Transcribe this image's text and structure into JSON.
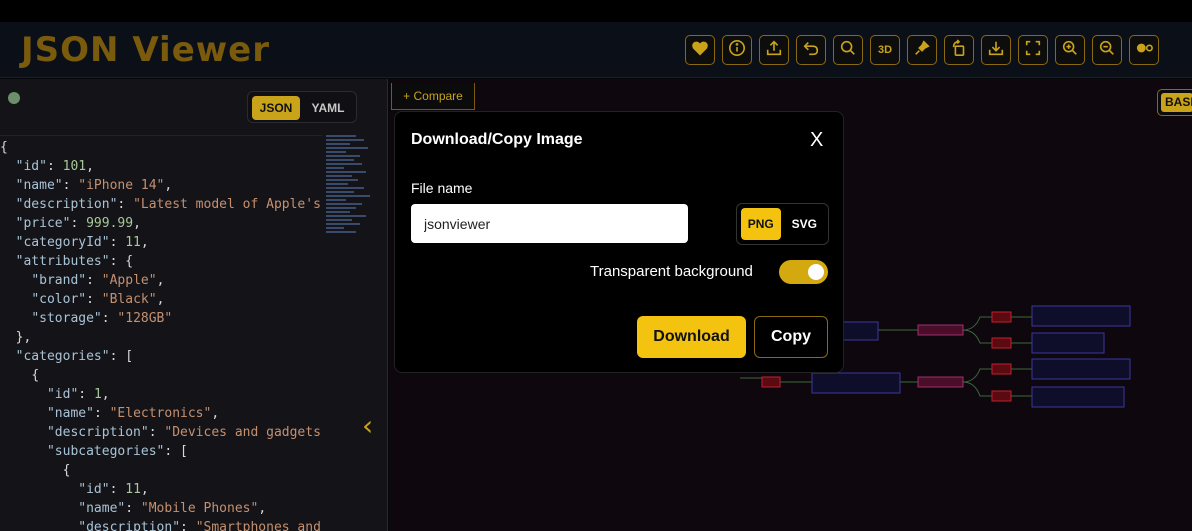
{
  "app": {
    "title": "JSON Viewer"
  },
  "toolbar": {
    "items": [
      {
        "icon": "heart-icon"
      },
      {
        "icon": "info-icon"
      },
      {
        "icon": "upload-icon"
      },
      {
        "icon": "undo-icon"
      },
      {
        "icon": "search-icon"
      },
      {
        "icon": "3d-icon",
        "label": "3D"
      },
      {
        "icon": "pin-icon"
      },
      {
        "icon": "rotate-icon"
      },
      {
        "icon": "download-icon"
      },
      {
        "icon": "fullscreen-icon"
      },
      {
        "icon": "zoom-in-icon"
      },
      {
        "icon": "zoom-out-icon"
      },
      {
        "icon": "theme-toggle-icon"
      }
    ]
  },
  "editor": {
    "formats": {
      "json": "JSON",
      "yaml": "YAML",
      "selected": "JSON"
    },
    "lines": [
      {
        "indent": 0,
        "parts": [
          [
            "p",
            "{"
          ]
        ]
      },
      {
        "indent": 1,
        "parts": [
          [
            "k",
            "\"id\""
          ],
          [
            "p",
            ": "
          ],
          [
            "n",
            "101"
          ],
          [
            "p",
            ","
          ]
        ]
      },
      {
        "indent": 1,
        "parts": [
          [
            "k",
            "\"name\""
          ],
          [
            "p",
            ": "
          ],
          [
            "s",
            "\"iPhone 14\""
          ],
          [
            "p",
            ","
          ]
        ]
      },
      {
        "indent": 1,
        "parts": [
          [
            "k",
            "\"description\""
          ],
          [
            "p",
            ": "
          ],
          [
            "s",
            "\"Latest model of Apple's"
          ]
        ]
      },
      {
        "indent": 1,
        "parts": [
          [
            "k",
            "\"price\""
          ],
          [
            "p",
            ": "
          ],
          [
            "n",
            "999.99"
          ],
          [
            "p",
            ","
          ]
        ]
      },
      {
        "indent": 1,
        "parts": [
          [
            "k",
            "\"categoryId\""
          ],
          [
            "p",
            ": "
          ],
          [
            "n",
            "11"
          ],
          [
            "p",
            ","
          ]
        ]
      },
      {
        "indent": 1,
        "parts": [
          [
            "k",
            "\"attributes\""
          ],
          [
            "p",
            ": {"
          ]
        ]
      },
      {
        "indent": 2,
        "parts": [
          [
            "k",
            "\"brand\""
          ],
          [
            "p",
            ": "
          ],
          [
            "s",
            "\"Apple\""
          ],
          [
            "p",
            ","
          ]
        ]
      },
      {
        "indent": 2,
        "parts": [
          [
            "k",
            "\"color\""
          ],
          [
            "p",
            ": "
          ],
          [
            "s",
            "\"Black\""
          ],
          [
            "p",
            ","
          ]
        ]
      },
      {
        "indent": 2,
        "parts": [
          [
            "k",
            "\"storage\""
          ],
          [
            "p",
            ": "
          ],
          [
            "s",
            "\"128GB\""
          ]
        ]
      },
      {
        "indent": 1,
        "parts": [
          [
            "p",
            "},"
          ]
        ]
      },
      {
        "indent": 1,
        "parts": [
          [
            "k",
            "\"categories\""
          ],
          [
            "p",
            ": ["
          ]
        ]
      },
      {
        "indent": 2,
        "parts": [
          [
            "p",
            "{"
          ]
        ]
      },
      {
        "indent": 3,
        "parts": [
          [
            "k",
            "\"id\""
          ],
          [
            "p",
            ": "
          ],
          [
            "n",
            "1"
          ],
          [
            "p",
            ","
          ]
        ]
      },
      {
        "indent": 3,
        "parts": [
          [
            "k",
            "\"name\""
          ],
          [
            "p",
            ": "
          ],
          [
            "s",
            "\"Electronics\""
          ],
          [
            "p",
            ","
          ]
        ]
      },
      {
        "indent": 3,
        "parts": [
          [
            "k",
            "\"description\""
          ],
          [
            "p",
            ": "
          ],
          [
            "s",
            "\"Devices and gadgets\""
          ]
        ]
      },
      {
        "indent": 3,
        "parts": [
          [
            "k",
            "\"subcategories\""
          ],
          [
            "p",
            ": ["
          ]
        ]
      },
      {
        "indent": 4,
        "parts": [
          [
            "p",
            "{"
          ]
        ]
      },
      {
        "indent": 5,
        "parts": [
          [
            "k",
            "\"id\""
          ],
          [
            "p",
            ": "
          ],
          [
            "n",
            "11"
          ],
          [
            "p",
            ","
          ]
        ]
      },
      {
        "indent": 5,
        "parts": [
          [
            "k",
            "\"name\""
          ],
          [
            "p",
            ": "
          ],
          [
            "s",
            "\"Mobile Phones\""
          ],
          [
            "p",
            ","
          ]
        ]
      },
      {
        "indent": 5,
        "parts": [
          [
            "k",
            "\"description\""
          ],
          [
            "p",
            ": "
          ],
          [
            "s",
            "\"Smartphones and"
          ]
        ]
      }
    ]
  },
  "canvas": {
    "compare_label": "+ Compare",
    "mode_label": "BASIC"
  },
  "dialog": {
    "title": "Download/Copy Image",
    "close_label": "X",
    "file_name_label": "File name",
    "file_name_value": "jsonviewer",
    "formats": {
      "png": "PNG",
      "svg": "SVG",
      "selected": "PNG"
    },
    "transparent_label": "Transparent background",
    "transparent_on": true,
    "download_label": "Download",
    "copy_label": "Copy"
  },
  "colors": {
    "accent": "#f3c30f",
    "accent_dark": "#c9a31a",
    "logo": "#7a5a0c"
  }
}
